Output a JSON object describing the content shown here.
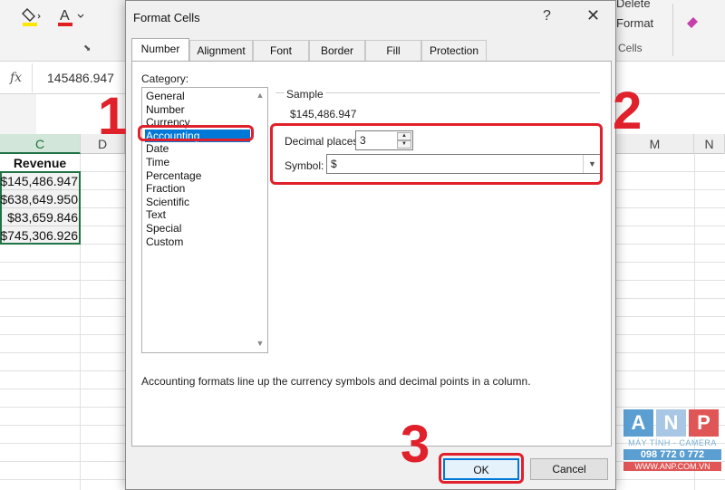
{
  "ribbon": {
    "right_items": [
      "Delete",
      "Format"
    ],
    "cells_group_label": "Cells"
  },
  "formula_bar": {
    "fx_label": "fx",
    "value": "145486.947"
  },
  "columns": {
    "left": [
      "C",
      "D"
    ],
    "right": [
      "M",
      "N"
    ]
  },
  "sheet": {
    "header": "Revenue",
    "values": [
      "$145,486.947",
      "$638,649.950",
      "$83,659.846",
      "$745,306.926"
    ]
  },
  "dialog": {
    "title": "Format Cells",
    "help": "?",
    "close": "✕",
    "tabs": [
      "Number",
      "Alignment",
      "Font",
      "Border",
      "Fill",
      "Protection"
    ],
    "category_label": "Category:",
    "categories": [
      "General",
      "Number",
      "Currency",
      "Accounting",
      "Date",
      "Time",
      "Percentage",
      "Fraction",
      "Scientific",
      "Text",
      "Special",
      "Custom"
    ],
    "selected_category": "Accounting",
    "sample_label": "Sample",
    "sample_value": "$145,486.947",
    "decimal_label": "Decimal places:",
    "decimal_value": "3",
    "symbol_label": "Symbol:",
    "symbol_value": "$",
    "description": "Accounting formats line up the currency symbols and decimal points in a column.",
    "ok_label": "OK",
    "cancel_label": "Cancel"
  },
  "annotations": {
    "step1": "1",
    "step2": "2",
    "step3": "3",
    "color": "#e0202a"
  },
  "logo": {
    "letters": [
      "A",
      "N",
      "P"
    ],
    "tagline": "MÁY TÍNH - CAMERA",
    "phone": "098 772 0 772",
    "site": "WWW.ANP.COM.VN",
    "colors": [
      "#5a9ed2",
      "#a7c7e4",
      "#e05656"
    ]
  }
}
